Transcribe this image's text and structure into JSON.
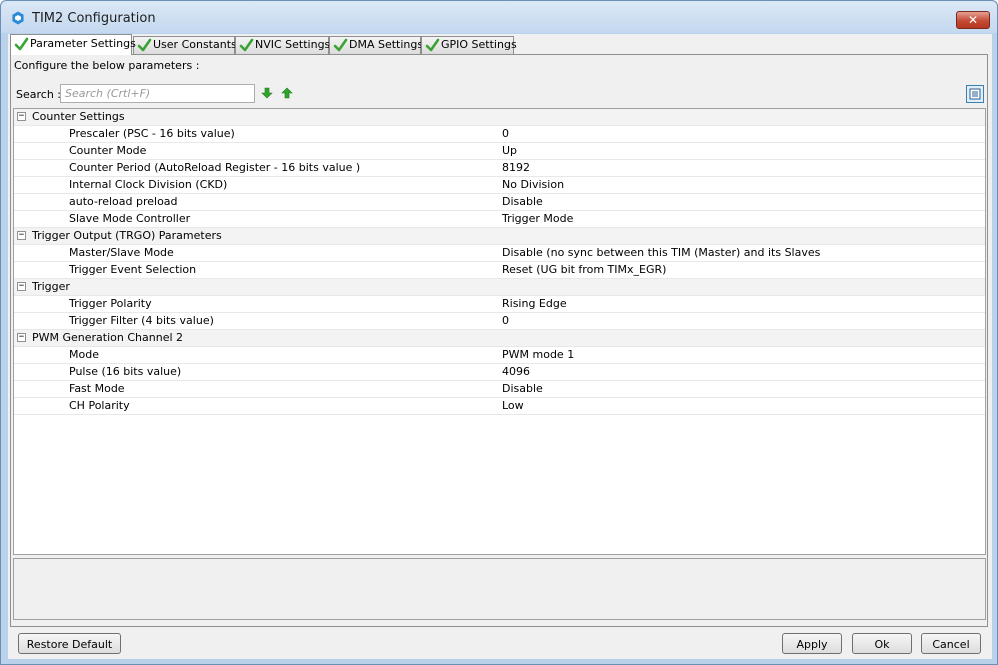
{
  "window": {
    "title": "TIM2 Configuration",
    "close_label": "✕"
  },
  "tabs": [
    {
      "label": "Parameter Settings"
    },
    {
      "label": "User Constants"
    },
    {
      "label": "NVIC Settings"
    },
    {
      "label": "DMA Settings"
    },
    {
      "label": "GPIO Settings"
    }
  ],
  "panel": {
    "config_label": "Configure the below parameters :",
    "search_label": "Search :",
    "search_placeholder": "Search (Crtl+F)",
    "search_value": ""
  },
  "groups": [
    {
      "label": "Counter Settings",
      "expander": "−",
      "params": [
        {
          "name": "Prescaler (PSC - 16 bits value)",
          "value": "0"
        },
        {
          "name": "Counter Mode",
          "value": "Up"
        },
        {
          "name": "Counter Period (AutoReload Register - 16 bits value )",
          "value": "8192"
        },
        {
          "name": "Internal Clock Division (CKD)",
          "value": "No Division"
        },
        {
          "name": "auto-reload preload",
          "value": "Disable"
        },
        {
          "name": "Slave Mode Controller",
          "value": "Trigger Mode"
        }
      ]
    },
    {
      "label": "Trigger Output (TRGO) Parameters",
      "expander": "−",
      "params": [
        {
          "name": "Master/Slave Mode",
          "value": "Disable (no sync between this TIM (Master) and its Slaves"
        },
        {
          "name": "Trigger Event Selection",
          "value": "Reset (UG bit from TIMx_EGR)"
        }
      ]
    },
    {
      "label": "Trigger",
      "expander": "−",
      "params": [
        {
          "name": "Trigger Polarity",
          "value": "Rising Edge"
        },
        {
          "name": "Trigger Filter (4 bits value)",
          "value": "0"
        }
      ]
    },
    {
      "label": "PWM Generation Channel 2",
      "expander": "−",
      "params": [
        {
          "name": "Mode",
          "value": "PWM mode 1"
        },
        {
          "name": "Pulse (16 bits value)",
          "value": "4096"
        },
        {
          "name": "Fast Mode",
          "value": "Disable"
        },
        {
          "name": "CH Polarity",
          "value": "Low"
        }
      ]
    }
  ],
  "buttons": {
    "restore_default": "Restore Default",
    "apply": "Apply",
    "ok": "Ok",
    "cancel": "Cancel"
  },
  "colors": {
    "check_green": "#3aa335",
    "arrow_green": "#2fa52a",
    "close_red": "#c54a34"
  }
}
